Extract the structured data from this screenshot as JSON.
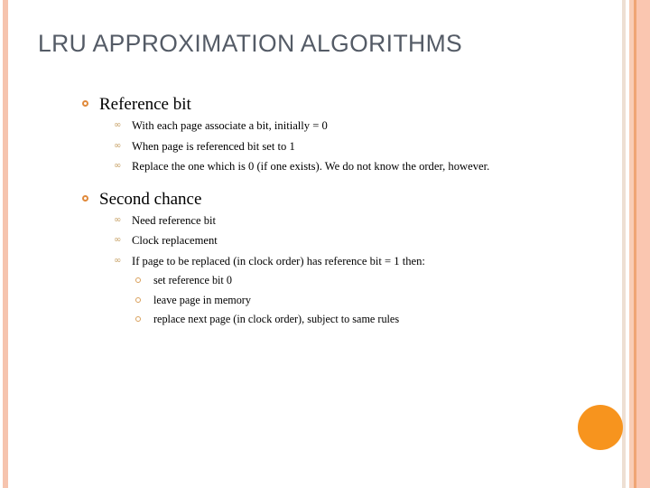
{
  "slide": {
    "title": "LRU APPROXIMATION ALGORITHMS",
    "colors": {
      "title_text": "#545b66",
      "body_text": "#000000",
      "accent_circle": "#f7941e",
      "border_salmon": "#f6c4ae",
      "border_orange_line": "#f0a575",
      "bullet_level1": "#e08a3c",
      "bullet_level2": "#c9a46b",
      "bullet_level3": "#d9a05c",
      "background": "#ffffff"
    },
    "markers": {
      "level1_icon": "hollow-ring-bullet",
      "level2_glyph": "@",
      "level2_icon": "infinity-scroll-bullet",
      "level3_icon": "small-hollow-ring-bullet"
    },
    "sections": [
      {
        "heading": "Reference bit",
        "items": [
          {
            "text": "With each page associate a bit, initially = 0"
          },
          {
            "text": "When page is referenced bit set to 1"
          },
          {
            "text": "Replace the one which is 0 (if one exists).  We do not know the order, however."
          }
        ]
      },
      {
        "heading": "Second chance",
        "items": [
          {
            "text": "Need reference bit"
          },
          {
            "text": "Clock replacement"
          },
          {
            "text": "If page to be replaced (in clock order) has reference bit = 1 then:",
            "subitems": [
              "set reference bit 0",
              "leave page in memory",
              "replace next page (in clock order), subject to same rules"
            ]
          }
        ]
      }
    ]
  }
}
